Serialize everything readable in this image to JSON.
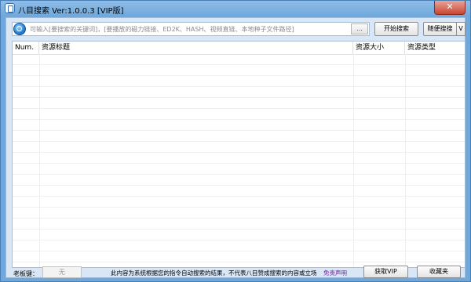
{
  "window": {
    "title": "八目搜索 Ver:1.0.0.3 [VIP版]",
    "close_label": "✕"
  },
  "search": {
    "placeholder": "可输入[要搜索的关键词]，[要播放的磁力链接、ED2K、HASH、视频直链、本地种子文件路径]",
    "browse_label": "...",
    "search_button": "开始搜索",
    "random_button": "随便搜搜",
    "dropdown_label": "V"
  },
  "table": {
    "columns": [
      "Num.",
      "资源标题",
      "资源大小",
      "资源类型"
    ],
    "rows": []
  },
  "footer": {
    "key_label": "老板键：",
    "key_value": "无",
    "notice": "此内容为系统根据您的指令自动搜索的结果，不代表八目赞成搜索的内容或立场",
    "disclaimer": "免责声明",
    "vip_button": "获取VIP",
    "favorites_button": "收藏夹"
  },
  "colors": {
    "frame": "#6fa8dc",
    "client": "#d9e6f5",
    "close": "#c84632",
    "disclaimer": "#7a22a8"
  }
}
